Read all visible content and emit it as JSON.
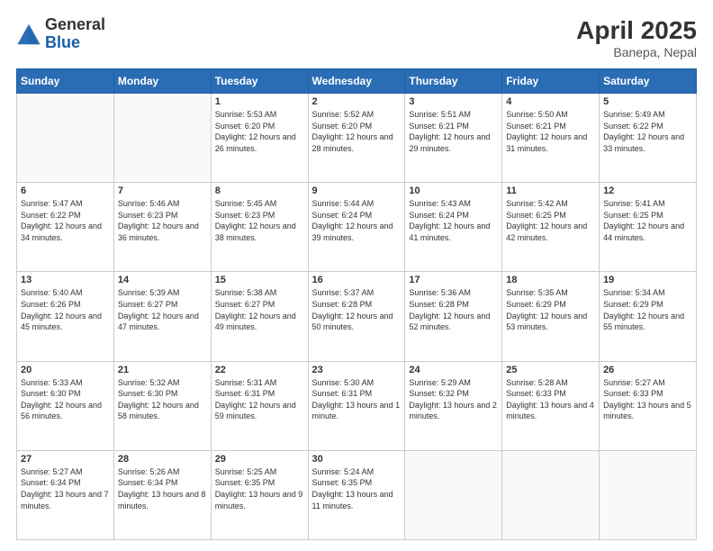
{
  "logo": {
    "general": "General",
    "blue": "Blue"
  },
  "title": "April 2025",
  "location": "Banepa, Nepal",
  "days_header": [
    "Sunday",
    "Monday",
    "Tuesday",
    "Wednesday",
    "Thursday",
    "Friday",
    "Saturday"
  ],
  "weeks": [
    [
      {
        "day": "",
        "info": ""
      },
      {
        "day": "",
        "info": ""
      },
      {
        "day": "1",
        "info": "Sunrise: 5:53 AM\nSunset: 6:20 PM\nDaylight: 12 hours and 26 minutes."
      },
      {
        "day": "2",
        "info": "Sunrise: 5:52 AM\nSunset: 6:20 PM\nDaylight: 12 hours and 28 minutes."
      },
      {
        "day": "3",
        "info": "Sunrise: 5:51 AM\nSunset: 6:21 PM\nDaylight: 12 hours and 29 minutes."
      },
      {
        "day": "4",
        "info": "Sunrise: 5:50 AM\nSunset: 6:21 PM\nDaylight: 12 hours and 31 minutes."
      },
      {
        "day": "5",
        "info": "Sunrise: 5:49 AM\nSunset: 6:22 PM\nDaylight: 12 hours and 33 minutes."
      }
    ],
    [
      {
        "day": "6",
        "info": "Sunrise: 5:47 AM\nSunset: 6:22 PM\nDaylight: 12 hours and 34 minutes."
      },
      {
        "day": "7",
        "info": "Sunrise: 5:46 AM\nSunset: 6:23 PM\nDaylight: 12 hours and 36 minutes."
      },
      {
        "day": "8",
        "info": "Sunrise: 5:45 AM\nSunset: 6:23 PM\nDaylight: 12 hours and 38 minutes."
      },
      {
        "day": "9",
        "info": "Sunrise: 5:44 AM\nSunset: 6:24 PM\nDaylight: 12 hours and 39 minutes."
      },
      {
        "day": "10",
        "info": "Sunrise: 5:43 AM\nSunset: 6:24 PM\nDaylight: 12 hours and 41 minutes."
      },
      {
        "day": "11",
        "info": "Sunrise: 5:42 AM\nSunset: 6:25 PM\nDaylight: 12 hours and 42 minutes."
      },
      {
        "day": "12",
        "info": "Sunrise: 5:41 AM\nSunset: 6:25 PM\nDaylight: 12 hours and 44 minutes."
      }
    ],
    [
      {
        "day": "13",
        "info": "Sunrise: 5:40 AM\nSunset: 6:26 PM\nDaylight: 12 hours and 45 minutes."
      },
      {
        "day": "14",
        "info": "Sunrise: 5:39 AM\nSunset: 6:27 PM\nDaylight: 12 hours and 47 minutes."
      },
      {
        "day": "15",
        "info": "Sunrise: 5:38 AM\nSunset: 6:27 PM\nDaylight: 12 hours and 49 minutes."
      },
      {
        "day": "16",
        "info": "Sunrise: 5:37 AM\nSunset: 6:28 PM\nDaylight: 12 hours and 50 minutes."
      },
      {
        "day": "17",
        "info": "Sunrise: 5:36 AM\nSunset: 6:28 PM\nDaylight: 12 hours and 52 minutes."
      },
      {
        "day": "18",
        "info": "Sunrise: 5:35 AM\nSunset: 6:29 PM\nDaylight: 12 hours and 53 minutes."
      },
      {
        "day": "19",
        "info": "Sunrise: 5:34 AM\nSunset: 6:29 PM\nDaylight: 12 hours and 55 minutes."
      }
    ],
    [
      {
        "day": "20",
        "info": "Sunrise: 5:33 AM\nSunset: 6:30 PM\nDaylight: 12 hours and 56 minutes."
      },
      {
        "day": "21",
        "info": "Sunrise: 5:32 AM\nSunset: 6:30 PM\nDaylight: 12 hours and 58 minutes."
      },
      {
        "day": "22",
        "info": "Sunrise: 5:31 AM\nSunset: 6:31 PM\nDaylight: 12 hours and 59 minutes."
      },
      {
        "day": "23",
        "info": "Sunrise: 5:30 AM\nSunset: 6:31 PM\nDaylight: 13 hours and 1 minute."
      },
      {
        "day": "24",
        "info": "Sunrise: 5:29 AM\nSunset: 6:32 PM\nDaylight: 13 hours and 2 minutes."
      },
      {
        "day": "25",
        "info": "Sunrise: 5:28 AM\nSunset: 6:33 PM\nDaylight: 13 hours and 4 minutes."
      },
      {
        "day": "26",
        "info": "Sunrise: 5:27 AM\nSunset: 6:33 PM\nDaylight: 13 hours and 5 minutes."
      }
    ],
    [
      {
        "day": "27",
        "info": "Sunrise: 5:27 AM\nSunset: 6:34 PM\nDaylight: 13 hours and 7 minutes."
      },
      {
        "day": "28",
        "info": "Sunrise: 5:26 AM\nSunset: 6:34 PM\nDaylight: 13 hours and 8 minutes."
      },
      {
        "day": "29",
        "info": "Sunrise: 5:25 AM\nSunset: 6:35 PM\nDaylight: 13 hours and 9 minutes."
      },
      {
        "day": "30",
        "info": "Sunrise: 5:24 AM\nSunset: 6:35 PM\nDaylight: 13 hours and 11 minutes."
      },
      {
        "day": "",
        "info": ""
      },
      {
        "day": "",
        "info": ""
      },
      {
        "day": "",
        "info": ""
      }
    ]
  ]
}
